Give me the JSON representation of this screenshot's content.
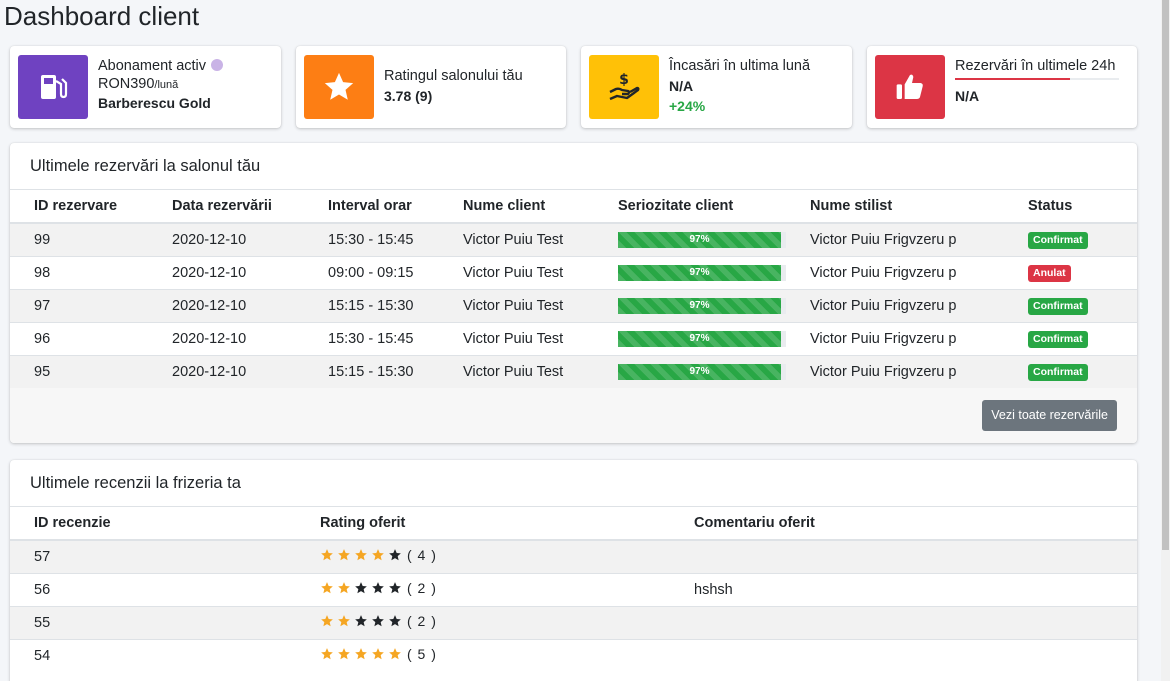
{
  "page_title": "Dashboard client",
  "info_boxes": {
    "subscription": {
      "label": "Abonament activ",
      "price": "RON390",
      "unit": "/lună",
      "plan": "Barberescu Gold",
      "icon": "fuel-pump-icon",
      "color": "#6f42c1"
    },
    "rating": {
      "label": "Ratingul salonului tău",
      "value": "3.78 (9)",
      "icon": "star-icon",
      "color": "#fd7e14"
    },
    "income": {
      "label": "Încasări în ultima lună",
      "value": "N/A",
      "change": "+24%",
      "icon": "hand-dollar-icon",
      "color": "#ffc107"
    },
    "bookings": {
      "label": "Rezervări în ultimele 24h",
      "value": "N/A",
      "progress": 0.7,
      "icon": "thumbs-up-icon",
      "color": "#dc3545"
    }
  },
  "reservations": {
    "title": "Ultimele rezervări la salonul tău",
    "columns": [
      "ID rezervare",
      "Data rezervării",
      "Interval orar",
      "Nume client",
      "Seriozitate client",
      "Nume stilist",
      "Status"
    ],
    "rows": [
      {
        "id": "99",
        "date": "2020-12-10",
        "interval": "15:30 - 15:45",
        "client": "Victor Puiu Test",
        "seriousness": "97%",
        "stylist": "Victor Puiu Frigvzeru p",
        "status": "Confirmat",
        "status_type": "success"
      },
      {
        "id": "98",
        "date": "2020-12-10",
        "interval": "09:00 - 09:15",
        "client": "Victor Puiu Test",
        "seriousness": "97%",
        "stylist": "Victor Puiu Frigvzeru p",
        "status": "Anulat",
        "status_type": "danger"
      },
      {
        "id": "97",
        "date": "2020-12-10",
        "interval": "15:15 - 15:30",
        "client": "Victor Puiu Test",
        "seriousness": "97%",
        "stylist": "Victor Puiu Frigvzeru p",
        "status": "Confirmat",
        "status_type": "success"
      },
      {
        "id": "96",
        "date": "2020-12-10",
        "interval": "15:30 - 15:45",
        "client": "Victor Puiu Test",
        "seriousness": "97%",
        "stylist": "Victor Puiu Frigvzeru p",
        "status": "Confirmat",
        "status_type": "success"
      },
      {
        "id": "95",
        "date": "2020-12-10",
        "interval": "15:15 - 15:30",
        "client": "Victor Puiu Test",
        "seriousness": "97%",
        "stylist": "Victor Puiu Frigvzeru p",
        "status": "Confirmat",
        "status_type": "success"
      }
    ],
    "view_all_label": "Vezi toate rezervările"
  },
  "reviews": {
    "title": "Ultimele recenzii la frizeria ta",
    "columns": [
      "ID recenzie",
      "Rating oferit",
      "Comentariu oferit"
    ],
    "rows": [
      {
        "id": "57",
        "rating": 4,
        "rating_label": "( 4 )",
        "comment": ""
      },
      {
        "id": "56",
        "rating": 2,
        "rating_label": "( 2 )",
        "comment": "hshsh"
      },
      {
        "id": "55",
        "rating": 2,
        "rating_label": "( 2 )",
        "comment": ""
      },
      {
        "id": "54",
        "rating": 5,
        "rating_label": "( 5 )",
        "comment": ""
      }
    ],
    "star_filled_color": "#f5a623",
    "star_empty_color": "#212529"
  }
}
